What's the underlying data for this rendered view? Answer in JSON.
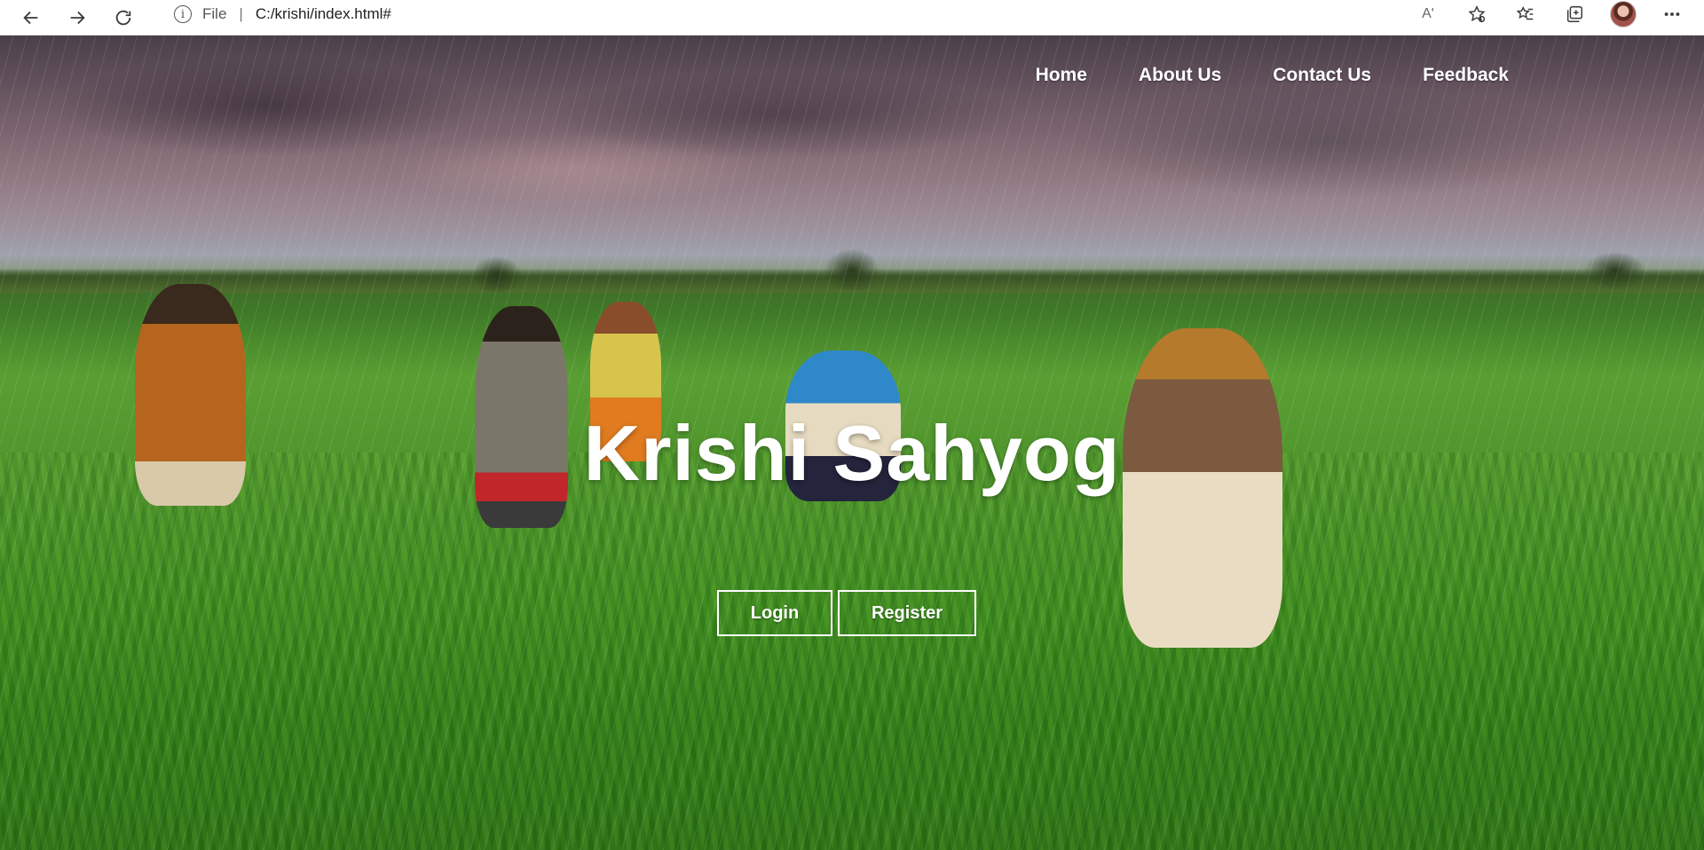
{
  "browser": {
    "scheme": "File",
    "separator": "|",
    "url": "C:/krishi/index.html#",
    "read_aloud_text": "Aʹ",
    "icons": {
      "back": "arrow-left-icon",
      "forward": "arrow-right-icon",
      "refresh": "refresh-icon",
      "info": "info-icon",
      "favorite": "star-add-icon",
      "favorites": "favorites-list-icon",
      "collections": "collections-icon",
      "profile": "avatar",
      "menu": "more-icon"
    }
  },
  "site": {
    "nav": [
      "Home",
      "About Us",
      "Contact Us",
      "Feedback"
    ],
    "title": "Krishi Sahyog",
    "buttons": {
      "login": "Login",
      "register": "Register"
    }
  },
  "colors": {
    "nav_text": "#ffffff",
    "title_text": "#ffffff",
    "button_border": "#ffffff"
  }
}
